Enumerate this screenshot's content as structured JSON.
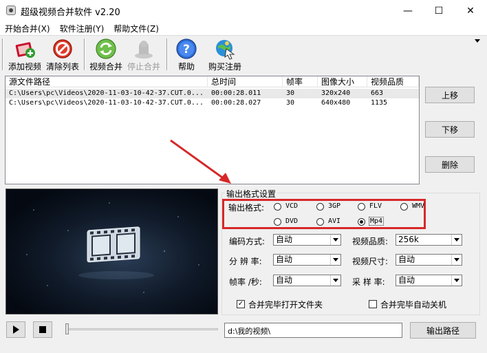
{
  "window": {
    "title": "超级视频合并软件 v2.20",
    "minimize_glyph": "—",
    "maximize_glyph": "☐",
    "close_glyph": "✕"
  },
  "menu": [
    "开始合并(X)",
    "软件注册(Y)",
    "帮助文件(Z)"
  ],
  "toolbar": {
    "add_video": "添加视频",
    "clear_list": "清除列表",
    "merge_video": "视频合并",
    "stop_merge": "停止合并",
    "help": "帮助",
    "buy": "购买注册"
  },
  "file_list": {
    "columns": [
      "源文件路径",
      "总时间",
      "帧率",
      "图像大小",
      "视频品质"
    ],
    "rows": [
      {
        "path": "C:\\Users\\pc\\Videos\\2020-11-03-10-42-37.CUT.0...",
        "duration": "00:00:28.011",
        "fps": "30",
        "size": "320x240",
        "quality": "663"
      },
      {
        "path": "C:\\Users\\pc\\Videos\\2020-11-03-10-42-37.CUT.0...",
        "duration": "00:00:28.027",
        "fps": "30",
        "size": "640x480",
        "quality": "1135"
      }
    ]
  },
  "side_buttons": {
    "move_up": "上移",
    "move_down": "下移",
    "delete": "删除"
  },
  "output": {
    "group_title": "输出格式设置",
    "format_label": "输出格式:",
    "formats": [
      "VCD",
      "3GP",
      "FLV",
      "WMV",
      "DVD",
      "AVI",
      "Mp4"
    ],
    "selected_format": "Mp4",
    "encoding": {
      "label": "编码方式:",
      "value": "自动"
    },
    "quality": {
      "label": "视频品质:",
      "value": "256k"
    },
    "resolution": {
      "label": "分 辨 率:",
      "value": "自动"
    },
    "video_size": {
      "label": "视频尺寸:",
      "value": "自动"
    },
    "framerate": {
      "label": "帧率 /秒:",
      "value": "自动"
    },
    "sample_rate": {
      "label": "采 样 率:",
      "value": "自动"
    },
    "open_folder": {
      "label": "合并完毕打开文件夹",
      "checked": true
    },
    "auto_shutdown": {
      "label": "合并完毕自动关机",
      "checked": false
    }
  },
  "bottom": {
    "output_path_value": "d:\\我的视频\\",
    "output_path_button": "输出路径"
  },
  "colors": {
    "annotation_red": "#d62828",
    "panel_bg": "#f0f0f0"
  },
  "icons": {
    "add_video": "add-film-icon",
    "clear_list": "no-entry-icon",
    "merge_video": "recycle-icon",
    "stop_merge": "stop-icon",
    "help": "question-icon",
    "buy": "globe-cursor-icon"
  }
}
